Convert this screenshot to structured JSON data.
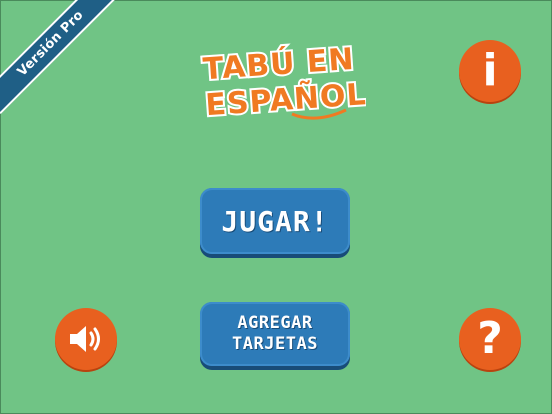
{
  "ribbon": {
    "label": "Versión Pro"
  },
  "logo": {
    "line1": "TABÚ EN",
    "line2": "ESPAÑOL",
    "fill_color": "#f07a22",
    "outline_color": "#ffffff"
  },
  "buttons": {
    "play_label": "JUGAR!",
    "add_cards_line1": "AGREGAR",
    "add_cards_line2": "TARJETAS",
    "info_icon": "info-icon",
    "sound_icon": "speaker-icon",
    "help_icon": "question-mark-icon",
    "info_glyph": "i",
    "help_glyph": "?"
  },
  "colors": {
    "background": "#70c485",
    "accent_orange": "#e8601f",
    "button_blue": "#2d7bb8",
    "ribbon_blue": "#1f5f86"
  }
}
